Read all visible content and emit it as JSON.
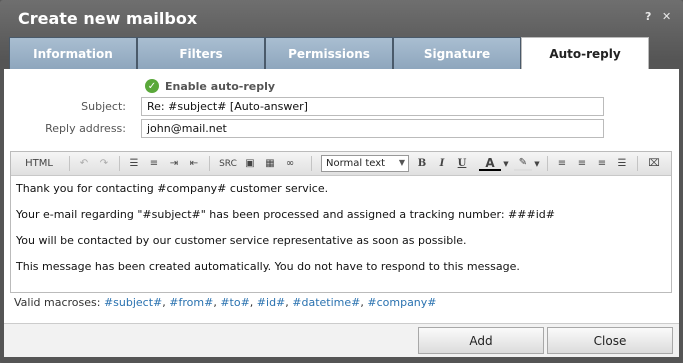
{
  "dialog": {
    "title": "Create new mailbox",
    "help_glyph": "?",
    "close_glyph": "✕"
  },
  "tabs": [
    {
      "label": "Information",
      "active": false
    },
    {
      "label": "Filters",
      "active": false
    },
    {
      "label": "Permissions",
      "active": false
    },
    {
      "label": "Signature",
      "active": false
    },
    {
      "label": "Auto-reply",
      "active": true
    }
  ],
  "autoreply": {
    "enable_label": "Enable auto-reply",
    "enable_icon": "check-circle-icon",
    "subject_label": "Subject:",
    "subject_value": "Re: #subject# [Auto-answer]",
    "reply_label": "Reply address:",
    "reply_value": "john@mail.net"
  },
  "toolbar": {
    "html_label": "HTML",
    "src_label": "SRC",
    "format_value": "Normal text",
    "bold": "B",
    "italic": "I",
    "underline": "U",
    "font_color": "A"
  },
  "message": {
    "lines": [
      "Thank you for contacting #company# customer service.",
      "Your e-mail regarding \"#subject#\" has been processed and assigned a tracking number: ###id#",
      "You will be contacted by our customer service representative as soon as possible.",
      "This message has been created automatically. You do not have to respond to this message."
    ]
  },
  "macros": {
    "label": "Valid macroses:",
    "items": [
      "#subject#",
      "#from#",
      "#to#",
      "#id#",
      "#datetime#",
      "#company#"
    ]
  },
  "footer": {
    "add_label": "Add",
    "close_label": "Close"
  },
  "colors": {
    "tab_bg": "#8ea6bd",
    "macro_link": "#2a72b0",
    "check_green": "#5aa83a"
  }
}
